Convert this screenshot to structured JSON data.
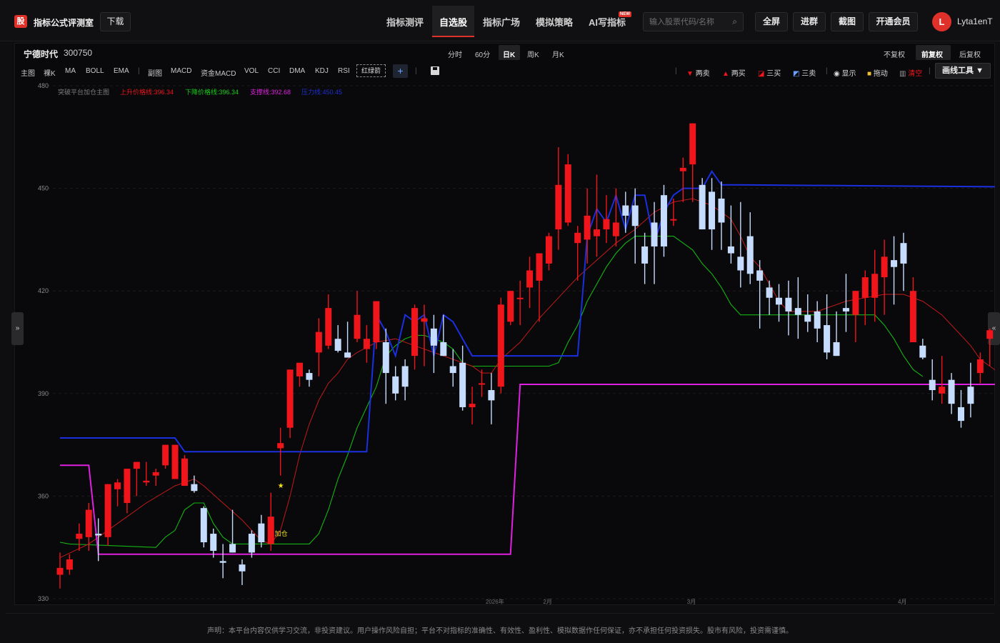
{
  "header": {
    "logo_char": "股",
    "site_title": "指标公式评测室",
    "download": "下载",
    "nav": [
      "指标测评",
      "自选股",
      "指标广场",
      "模拟策略",
      "AI写指标"
    ],
    "nav_active": "自选股",
    "new_badge": "NEW",
    "search_placeholder": "输入股票代码/名称",
    "buttons": [
      "全屏",
      "进群",
      "截图",
      "开通会员"
    ],
    "avatar_letter": "L",
    "username": "Lyta1enT"
  },
  "stock": {
    "name": "宁德时代",
    "code": "300750"
  },
  "periods": [
    "分时",
    "60分",
    "日K",
    "周K",
    "月K"
  ],
  "period_active": "日K",
  "adjust": [
    "不复权",
    "前复权",
    "后复权"
  ],
  "adjust_active": "前复权",
  "toolbar": {
    "main_label": "主图",
    "main": [
      "裸K",
      "MA",
      "BOLL",
      "EMA"
    ],
    "sub_label": "副图",
    "sub": [
      "MACD",
      "资金MACD",
      "VOL",
      "CCI",
      "DMA",
      "KDJ",
      "RSI"
    ],
    "redgreen": "红绿箭",
    "plus": "+"
  },
  "right_tools": {
    "sell2": "两卖",
    "buy2": "两买",
    "buy3": "三买",
    "sell3": "三卖",
    "show": "显示",
    "drag": "拖动",
    "clear": "清空",
    "draw_tool": "画线工具 ▼"
  },
  "legend": {
    "name": "突破平台加仓主图",
    "up_line": "上升价格线:396.34",
    "down_line": "下降价格线:396.34",
    "support": "支撑线:392.68",
    "resistance": "压力线:450.45"
  },
  "signals": {
    "star": "★",
    "add": "加仓"
  },
  "colors": {
    "up": "#f0151a",
    "down": "#c6dcff",
    "blue": "#1a2fe0",
    "magenta": "#e020e0",
    "green": "#14b414",
    "red_line": "#c01a1a",
    "accent": "#e0302a"
  },
  "chart_data": {
    "type": "candlestick",
    "ylim": [
      330,
      480
    ],
    "yticks": [
      330,
      360,
      390,
      420,
      450,
      480
    ],
    "xlabels": [
      "2026年",
      "2月",
      "3月",
      "4月"
    ],
    "candles": [
      {
        "o": 337.0,
        "h": 343.5,
        "l": 333.0,
        "c": 339.0
      },
      {
        "o": 338.5,
        "h": 343.0,
        "l": 337.0,
        "c": 341.5
      },
      {
        "o": 347.5,
        "h": 352.0,
        "l": 344.0,
        "c": 349.0
      },
      {
        "o": 348.0,
        "h": 358.0,
        "l": 344.0,
        "c": 356.0
      },
      {
        "o": 349.0,
        "h": 353.5,
        "l": 341.0,
        "c": 348.5
      },
      {
        "o": 348.0,
        "h": 362.5,
        "l": 345.5,
        "c": 363.5
      },
      {
        "o": 362.0,
        "h": 365.0,
        "l": 357.0,
        "c": 364.0
      },
      {
        "o": 358.0,
        "h": 367.5,
        "l": 355.0,
        "c": 368.0
      },
      {
        "o": 368.0,
        "h": 370.0,
        "l": 360.0,
        "c": 370.0
      },
      {
        "o": 364.0,
        "h": 370.0,
        "l": 363.0,
        "c": 364.5
      },
      {
        "o": 366.0,
        "h": 368.0,
        "l": 363.0,
        "c": 367.0
      },
      {
        "o": 369.0,
        "h": 375.0,
        "l": 368.0,
        "c": 375.0
      },
      {
        "o": 365.0,
        "h": 375.0,
        "l": 365.0,
        "c": 375.0
      },
      {
        "o": 363.0,
        "h": 372.0,
        "l": 363.0,
        "c": 371.0
      },
      {
        "o": 363.5,
        "h": 366.0,
        "l": 361.0,
        "c": 361.5
      },
      {
        "o": 356.5,
        "h": 357.0,
        "l": 345.0,
        "c": 346.5
      },
      {
        "o": 349.0,
        "h": 350.5,
        "l": 342.0,
        "c": 344.0
      },
      {
        "o": 341.0,
        "h": 346.0,
        "l": 336.0,
        "c": 340.5
      },
      {
        "o": 346.0,
        "h": 356.0,
        "l": 344.0,
        "c": 343.5
      },
      {
        "o": 340.0,
        "h": 341.5,
        "l": 334.0,
        "c": 338.0
      },
      {
        "o": 349.0,
        "h": 350.0,
        "l": 342.0,
        "c": 343.5
      },
      {
        "o": 352.0,
        "h": 354.5,
        "l": 345.0,
        "c": 346.5
      },
      {
        "o": 346.0,
        "h": 361.0,
        "l": 344.0,
        "c": 354.0
      },
      {
        "o": 374.0,
        "h": 380.0,
        "l": 366.0,
        "c": 375.5
      },
      {
        "o": 380.0,
        "h": 393.0,
        "l": 377.0,
        "c": 397.0
      },
      {
        "o": 395.0,
        "h": 399.0,
        "l": 392.0,
        "c": 399.0
      },
      {
        "o": 396.0,
        "h": 397.0,
        "l": 392.0,
        "c": 394.0
      },
      {
        "o": 402.0,
        "h": 412.0,
        "l": 395.0,
        "c": 408.0
      },
      {
        "o": 404.0,
        "h": 419.0,
        "l": 403.0,
        "c": 415.0
      },
      {
        "o": 406.0,
        "h": 410.0,
        "l": 402.0,
        "c": 402.5
      },
      {
        "o": 402.0,
        "h": 411.0,
        "l": 401.0,
        "c": 400.5
      },
      {
        "o": 406.0,
        "h": 420.0,
        "l": 405.0,
        "c": 413.0
      },
      {
        "o": 403.0,
        "h": 410.0,
        "l": 399.0,
        "c": 406.0
      },
      {
        "o": 405.0,
        "h": 412.0,
        "l": 403.0,
        "c": 417.0
      },
      {
        "o": 405.0,
        "h": 409.0,
        "l": 387.0,
        "c": 396.0
      },
      {
        "o": 395.0,
        "h": 398.0,
        "l": 388.0,
        "c": 390.0
      },
      {
        "o": 398.0,
        "h": 400.0,
        "l": 388.0,
        "c": 392.0
      },
      {
        "o": 401.0,
        "h": 416.0,
        "l": 397.0,
        "c": 415.0
      },
      {
        "o": 411.0,
        "h": 416.0,
        "l": 398.0,
        "c": 412.0
      },
      {
        "o": 409.0,
        "h": 413.0,
        "l": 396.0,
        "c": 404.0
      },
      {
        "o": 405.0,
        "h": 413.0,
        "l": 403.0,
        "c": 401.0
      },
      {
        "o": 398.0,
        "h": 403.0,
        "l": 392.0,
        "c": 396.0
      },
      {
        "o": 399.0,
        "h": 404.0,
        "l": 385.0,
        "c": 386.0
      },
      {
        "o": 386.0,
        "h": 392.0,
        "l": 381.0,
        "c": 387.0
      },
      {
        "o": 393.0,
        "h": 397.0,
        "l": 389.0,
        "c": 393.0
      },
      {
        "o": 391.0,
        "h": 396.0,
        "l": 381.0,
        "c": 388.0
      },
      {
        "o": 392.0,
        "h": 418.0,
        "l": 390.0,
        "c": 416.0
      },
      {
        "o": 411.0,
        "h": 419.0,
        "l": 410.0,
        "c": 420.0
      },
      {
        "o": 418.0,
        "h": 423.0,
        "l": 410.0,
        "c": 418.0
      },
      {
        "o": 421.0,
        "h": 430.0,
        "l": 415.0,
        "c": 426.0
      },
      {
        "o": 423.0,
        "h": 430.0,
        "l": 411.0,
        "c": 431.0
      },
      {
        "o": 428.0,
        "h": 437.0,
        "l": 426.0,
        "c": 436.0
      },
      {
        "o": 438.0,
        "h": 462.0,
        "l": 432.0,
        "c": 451.0
      },
      {
        "o": 440.0,
        "h": 460.0,
        "l": 439.0,
        "c": 457.0
      },
      {
        "o": 434.0,
        "h": 439.0,
        "l": 423.0,
        "c": 437.0
      },
      {
        "o": 435.0,
        "h": 450.0,
        "l": 428.0,
        "c": 442.0
      },
      {
        "o": 436.0,
        "h": 454.0,
        "l": 430.0,
        "c": 438.0
      },
      {
        "o": 438.0,
        "h": 448.0,
        "l": 434.0,
        "c": 441.0
      },
      {
        "o": 436.0,
        "h": 450.0,
        "l": 433.0,
        "c": 440.0
      },
      {
        "o": 445.0,
        "h": 449.0,
        "l": 437.0,
        "c": 442.0
      },
      {
        "o": 445.0,
        "h": 450.0,
        "l": 428.0,
        "c": 439.0
      },
      {
        "o": 433.0,
        "h": 437.0,
        "l": 422.0,
        "c": 428.0
      },
      {
        "o": 440.0,
        "h": 446.0,
        "l": 422.0,
        "c": 433.0
      },
      {
        "o": 448.0,
        "h": 451.0,
        "l": 430.0,
        "c": 433.0
      },
      {
        "o": 441.0,
        "h": 447.0,
        "l": 439.0,
        "c": 441.0
      },
      {
        "o": 455.0,
        "h": 459.0,
        "l": 446.0,
        "c": 456.0
      },
      {
        "o": 457.0,
        "h": 462.0,
        "l": 446.0,
        "c": 469.0
      },
      {
        "o": 451.0,
        "h": 453.0,
        "l": 440.0,
        "c": 438.0
      },
      {
        "o": 449.0,
        "h": 453.0,
        "l": 432.0,
        "c": 438.0
      },
      {
        "o": 447.0,
        "h": 452.0,
        "l": 432.0,
        "c": 440.0
      },
      {
        "o": 433.0,
        "h": 445.0,
        "l": 428.0,
        "c": 431.0
      },
      {
        "o": 430.0,
        "h": 446.0,
        "l": 421.0,
        "c": 426.0
      },
      {
        "o": 436.0,
        "h": 443.0,
        "l": 422.0,
        "c": 425.0
      },
      {
        "o": 426.0,
        "h": 429.0,
        "l": 409.0,
        "c": 423.0
      },
      {
        "o": 421.0,
        "h": 423.0,
        "l": 413.0,
        "c": 418.0
      },
      {
        "o": 418.0,
        "h": 422.0,
        "l": 411.0,
        "c": 416.0
      },
      {
        "o": 418.0,
        "h": 423.0,
        "l": 407.0,
        "c": 414.0
      },
      {
        "o": 415.0,
        "h": 424.0,
        "l": 406.0,
        "c": 413.0
      },
      {
        "o": 413.0,
        "h": 419.0,
        "l": 408.0,
        "c": 411.0
      },
      {
        "o": 414.0,
        "h": 417.0,
        "l": 405.0,
        "c": 409.0
      },
      {
        "o": 410.0,
        "h": 419.0,
        "l": 400.0,
        "c": 402.0
      },
      {
        "o": 405.0,
        "h": 414.0,
        "l": 402.0,
        "c": 401.0
      },
      {
        "o": 415.0,
        "h": 425.0,
        "l": 408.0,
        "c": 414.0
      },
      {
        "o": 413.0,
        "h": 418.0,
        "l": 405.0,
        "c": 420.0
      },
      {
        "o": 418.0,
        "h": 426.0,
        "l": 410.0,
        "c": 424.0
      },
      {
        "o": 418.0,
        "h": 432.0,
        "l": 411.0,
        "c": 425.0
      },
      {
        "o": 424.0,
        "h": 435.0,
        "l": 413.0,
        "c": 430.0
      },
      {
        "o": 429.0,
        "h": 436.0,
        "l": 416.0,
        "c": 427.0
      },
      {
        "o": 434.0,
        "h": 437.0,
        "l": 420.0,
        "c": 428.0
      },
      {
        "o": 405.0,
        "h": 424.0,
        "l": 407.0,
        "c": 420.0
      },
      {
        "o": 404.0,
        "h": 406.0,
        "l": 400.0,
        "c": 400.5
      },
      {
        "o": 394.0,
        "h": 400.0,
        "l": 388.0,
        "c": 391.0
      },
      {
        "o": 390.0,
        "h": 401.0,
        "l": 387.0,
        "c": 392.0
      },
      {
        "o": 394.0,
        "h": 396.0,
        "l": 384.0,
        "c": 387.0
      },
      {
        "o": 386.0,
        "h": 391.0,
        "l": 380.0,
        "c": 382.0
      },
      {
        "o": 392.0,
        "h": 399.0,
        "l": 383.0,
        "c": 387.0
      },
      {
        "o": 396.0,
        "h": 402.0,
        "l": 393.0,
        "c": 400.0
      },
      {
        "o": 406.0,
        "h": 409.0,
        "l": 398.0,
        "c": 408.5
      }
    ],
    "resistance_line": [
      [
        0,
        377
      ],
      [
        12,
        377
      ],
      [
        13,
        373
      ],
      [
        32,
        373
      ],
      [
        33,
        413
      ],
      [
        34,
        408
      ],
      [
        35,
        401
      ],
      [
        36,
        413
      ],
      [
        37,
        411
      ],
      [
        38,
        413
      ],
      [
        39,
        401
      ],
      [
        40,
        413
      ],
      [
        41,
        411
      ],
      [
        42,
        406
      ],
      [
        43,
        401
      ],
      [
        47,
        401
      ],
      [
        54,
        401
      ],
      [
        55,
        436
      ],
      [
        56,
        444
      ],
      [
        57,
        440
      ],
      [
        58,
        448
      ],
      [
        59,
        438
      ],
      [
        60,
        448
      ],
      [
        61,
        448
      ],
      [
        62,
        434
      ],
      [
        63,
        443
      ],
      [
        64,
        448
      ],
      [
        65,
        450
      ],
      [
        67,
        450
      ],
      [
        68,
        455
      ],
      [
        69,
        451
      ],
      [
        70,
        451
      ],
      [
        71,
        451
      ],
      [
        98,
        450.45
      ]
    ],
    "support_line": [
      [
        0,
        369
      ],
      [
        3,
        369
      ],
      [
        4,
        343
      ],
      [
        47,
        343
      ],
      [
        48,
        392.68
      ],
      [
        98,
        392.68
      ]
    ],
    "green_line": [
      [
        0,
        346.5
      ],
      [
        1,
        346.0
      ],
      [
        10,
        345.0
      ],
      [
        11,
        348
      ],
      [
        12,
        350
      ],
      [
        13,
        356
      ],
      [
        14,
        358
      ],
      [
        15,
        358
      ],
      [
        16,
        352
      ],
      [
        17,
        348
      ],
      [
        18,
        346
      ],
      [
        19,
        346
      ],
      [
        20,
        346
      ],
      [
        21,
        346
      ],
      [
        22,
        346
      ],
      [
        23,
        346
      ],
      [
        24,
        346
      ],
      [
        25,
        346
      ],
      [
        26,
        346
      ],
      [
        27,
        349
      ],
      [
        28,
        356
      ],
      [
        29,
        365
      ],
      [
        30,
        372
      ],
      [
        31,
        380
      ],
      [
        32,
        386
      ],
      [
        33,
        392
      ],
      [
        34,
        401
      ],
      [
        35,
        404
      ],
      [
        36,
        406
      ],
      [
        37,
        407
      ],
      [
        38,
        407
      ],
      [
        39,
        406
      ],
      [
        40,
        405
      ],
      [
        41,
        403
      ],
      [
        42,
        399
      ],
      [
        43,
        398
      ],
      [
        44,
        398
      ],
      [
        45,
        398
      ],
      [
        46,
        398
      ],
      [
        47,
        398
      ],
      [
        48,
        398
      ],
      [
        49,
        398
      ],
      [
        50,
        398
      ],
      [
        51,
        398
      ],
      [
        52,
        399
      ],
      [
        53,
        405
      ],
      [
        54,
        410
      ],
      [
        55,
        417
      ],
      [
        56,
        422
      ],
      [
        57,
        427
      ],
      [
        58,
        431
      ],
      [
        59,
        434
      ],
      [
        60,
        436
      ],
      [
        61,
        436
      ],
      [
        62,
        436
      ],
      [
        63,
        436
      ],
      [
        64,
        436
      ],
      [
        65,
        434
      ],
      [
        66,
        432
      ],
      [
        67,
        428
      ],
      [
        68,
        425
      ],
      [
        69,
        421
      ],
      [
        70,
        416
      ],
      [
        71,
        413
      ],
      [
        72,
        413
      ],
      [
        73,
        413
      ],
      [
        74,
        413
      ],
      [
        75,
        413
      ],
      [
        76,
        413
      ],
      [
        77,
        413
      ],
      [
        78,
        413
      ],
      [
        79,
        413
      ],
      [
        80,
        413
      ],
      [
        81,
        413
      ],
      [
        82,
        413
      ],
      [
        83,
        413
      ],
      [
        84,
        413
      ],
      [
        85,
        413
      ],
      [
        86,
        410
      ],
      [
        87,
        406
      ],
      [
        88,
        401
      ],
      [
        89,
        397
      ],
      [
        90,
        395
      ]
    ],
    "red_line": [
      [
        0,
        342
      ],
      [
        3,
        346
      ],
      [
        6,
        352
      ],
      [
        9,
        358
      ],
      [
        12,
        363
      ],
      [
        14,
        365
      ],
      [
        15,
        363
      ],
      [
        17,
        358
      ],
      [
        19,
        353
      ],
      [
        20,
        350
      ],
      [
        21,
        347
      ],
      [
        22,
        346
      ],
      [
        23,
        350
      ],
      [
        24,
        360
      ],
      [
        25,
        372
      ],
      [
        26,
        381
      ],
      [
        27,
        388
      ],
      [
        28,
        393
      ],
      [
        29,
        396
      ],
      [
        30,
        400
      ],
      [
        31,
        402
      ],
      [
        33,
        405
      ],
      [
        35,
        406
      ],
      [
        37,
        404
      ],
      [
        39,
        402
      ],
      [
        41,
        400
      ],
      [
        43,
        398
      ],
      [
        44,
        396
      ],
      [
        45,
        396
      ],
      [
        46,
        400
      ],
      [
        48,
        405
      ],
      [
        50,
        412
      ],
      [
        52,
        418
      ],
      [
        54,
        424
      ],
      [
        56,
        429
      ],
      [
        58,
        434
      ],
      [
        60,
        438
      ],
      [
        62,
        443
      ],
      [
        64,
        446
      ],
      [
        66,
        447
      ],
      [
        67,
        446
      ],
      [
        68,
        445
      ],
      [
        69,
        443
      ],
      [
        70,
        441
      ],
      [
        71,
        436
      ],
      [
        72,
        430
      ],
      [
        73,
        427
      ],
      [
        74,
        422
      ],
      [
        75,
        417
      ],
      [
        76,
        414
      ],
      [
        77,
        414
      ],
      [
        78,
        414
      ],
      [
        79,
        414
      ],
      [
        80,
        415
      ],
      [
        82,
        417
      ],
      [
        84,
        418
      ],
      [
        86,
        419
      ],
      [
        88,
        419
      ],
      [
        90,
        417
      ],
      [
        92,
        413
      ],
      [
        93,
        410
      ],
      [
        94,
        407
      ],
      [
        95,
        404
      ],
      [
        96,
        400
      ],
      [
        97,
        398
      ],
      [
        98,
        396
      ]
    ],
    "star_at": [
      23,
      363
    ],
    "add_at": [
      23,
      349
    ]
  },
  "disclaimer": "声明：本平台内容仅供学习交流，非投资建议。用户操作风险自担；平台不对指标的准确性、有效性、盈利性、模拟数据作任何保证，亦不承担任何投资损失。股市有风险，投资需谨慎。"
}
